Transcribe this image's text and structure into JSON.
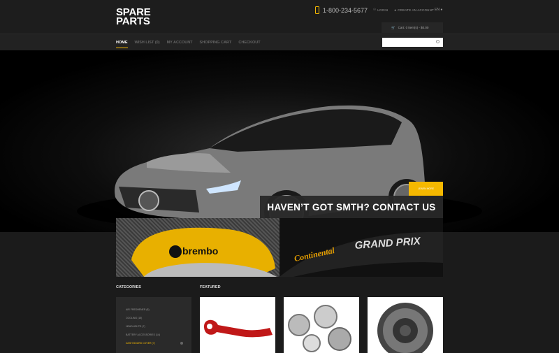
{
  "logo": {
    "line1": "SPARE",
    "line2": "PARTS"
  },
  "phone": "1-800-234-5677",
  "top_links": {
    "login": "LOGIN",
    "create": "CREATE AN ACCOUNT"
  },
  "lang": "EN",
  "cart": "Cart: 0 item(s) - $0.00",
  "nav": [
    "HOME",
    "WISH LIST (0)",
    "MY ACCOUNT",
    "SHOPPING CART",
    "CHECKOUT"
  ],
  "search": {
    "placeholder": ""
  },
  "hero": {
    "button": "LEARN MORE",
    "banner": "HAVEN’T GOT SMTH? CONTACT US"
  },
  "promos": {
    "left_brand": "brembo",
    "right_brand1": "Continental",
    "right_brand2": "GRAND PRIX"
  },
  "sections": {
    "categories": "CATEGORIES",
    "featured": "FEATURED"
  },
  "categories": [
    "AIR FRESHENER (8)",
    "COOLING (15)",
    "HEADLIGHTS (7)",
    "BATTERY ACCESSORIES (14)",
    "DASH BOARD COVER (7)"
  ],
  "colors": {
    "accent": "#f5b800",
    "bg": "#1b1b1b"
  }
}
